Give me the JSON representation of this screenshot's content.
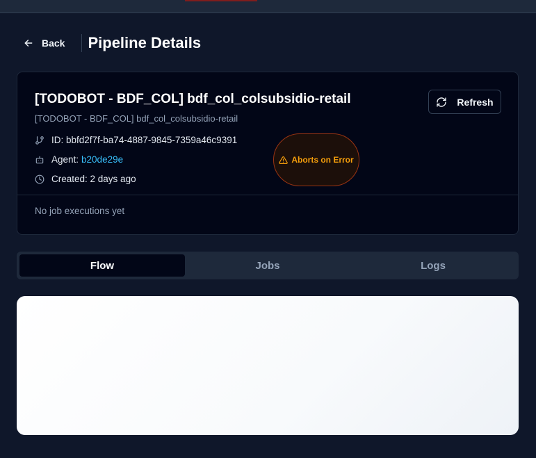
{
  "header": {
    "back_label": "Back",
    "title": "Pipeline Details"
  },
  "pipeline": {
    "name": "[TODOBOT - BDF_COL] bdf_col_colsubsidio-retail",
    "subtitle": "[TODOBOT - BDF_COL] bdf_col_colsubsidio-retail",
    "id_text": "ID: bbfd2f7f-ba74-4887-9845-7359a46c9391",
    "agent_label": "Agent:",
    "agent_value": "b20de29e",
    "created_text": "Created: 2 days ago",
    "badge_label": "Aborts on Error",
    "empty_jobs": "No job executions yet",
    "refresh_label": "Refresh"
  },
  "tabs": [
    {
      "label": "Flow",
      "active": true
    },
    {
      "label": "Jobs",
      "active": false
    },
    {
      "label": "Logs",
      "active": false
    }
  ],
  "colors": {
    "background": "#0f172a",
    "card": "#020617",
    "accent_link": "#38bdf8",
    "warning": "#f59e0b"
  },
  "icons": [
    "arrow-left-icon",
    "refresh-icon",
    "git-branch-icon",
    "bot-icon",
    "clock-icon",
    "warning-triangle-icon"
  ]
}
